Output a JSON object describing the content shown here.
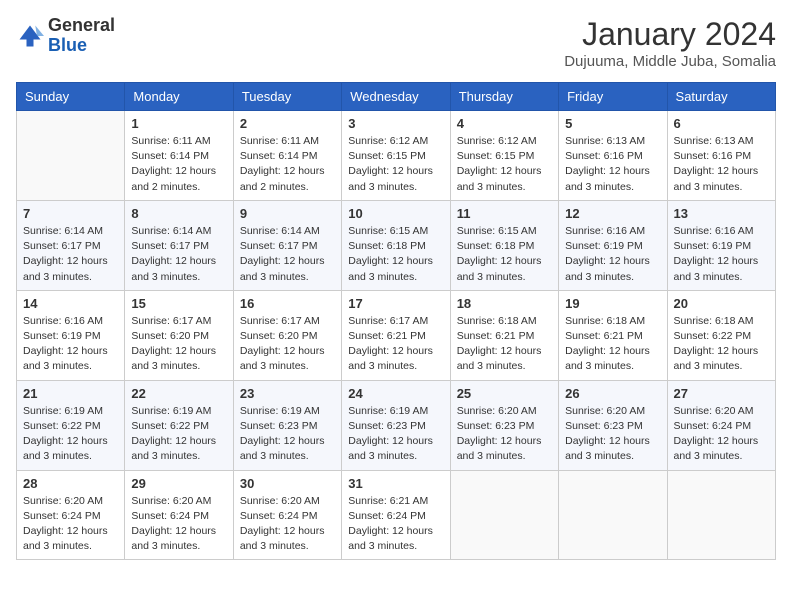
{
  "logo": {
    "general": "General",
    "blue": "Blue"
  },
  "header": {
    "month": "January 2024",
    "location": "Dujuuma, Middle Juba, Somalia"
  },
  "weekdays": [
    "Sunday",
    "Monday",
    "Tuesday",
    "Wednesday",
    "Thursday",
    "Friday",
    "Saturday"
  ],
  "weeks": [
    [
      {
        "day": null
      },
      {
        "day": 1,
        "sunrise": "6:11 AM",
        "sunset": "6:14 PM",
        "daylight": "12 hours and 2 minutes."
      },
      {
        "day": 2,
        "sunrise": "6:11 AM",
        "sunset": "6:14 PM",
        "daylight": "12 hours and 2 minutes."
      },
      {
        "day": 3,
        "sunrise": "6:12 AM",
        "sunset": "6:15 PM",
        "daylight": "12 hours and 3 minutes."
      },
      {
        "day": 4,
        "sunrise": "6:12 AM",
        "sunset": "6:15 PM",
        "daylight": "12 hours and 3 minutes."
      },
      {
        "day": 5,
        "sunrise": "6:13 AM",
        "sunset": "6:16 PM",
        "daylight": "12 hours and 3 minutes."
      },
      {
        "day": 6,
        "sunrise": "6:13 AM",
        "sunset": "6:16 PM",
        "daylight": "12 hours and 3 minutes."
      }
    ],
    [
      {
        "day": 7,
        "sunrise": "6:14 AM",
        "sunset": "6:17 PM",
        "daylight": "12 hours and 3 minutes."
      },
      {
        "day": 8,
        "sunrise": "6:14 AM",
        "sunset": "6:17 PM",
        "daylight": "12 hours and 3 minutes."
      },
      {
        "day": 9,
        "sunrise": "6:14 AM",
        "sunset": "6:17 PM",
        "daylight": "12 hours and 3 minutes."
      },
      {
        "day": 10,
        "sunrise": "6:15 AM",
        "sunset": "6:18 PM",
        "daylight": "12 hours and 3 minutes."
      },
      {
        "day": 11,
        "sunrise": "6:15 AM",
        "sunset": "6:18 PM",
        "daylight": "12 hours and 3 minutes."
      },
      {
        "day": 12,
        "sunrise": "6:16 AM",
        "sunset": "6:19 PM",
        "daylight": "12 hours and 3 minutes."
      },
      {
        "day": 13,
        "sunrise": "6:16 AM",
        "sunset": "6:19 PM",
        "daylight": "12 hours and 3 minutes."
      }
    ],
    [
      {
        "day": 14,
        "sunrise": "6:16 AM",
        "sunset": "6:19 PM",
        "daylight": "12 hours and 3 minutes."
      },
      {
        "day": 15,
        "sunrise": "6:17 AM",
        "sunset": "6:20 PM",
        "daylight": "12 hours and 3 minutes."
      },
      {
        "day": 16,
        "sunrise": "6:17 AM",
        "sunset": "6:20 PM",
        "daylight": "12 hours and 3 minutes."
      },
      {
        "day": 17,
        "sunrise": "6:17 AM",
        "sunset": "6:21 PM",
        "daylight": "12 hours and 3 minutes."
      },
      {
        "day": 18,
        "sunrise": "6:18 AM",
        "sunset": "6:21 PM",
        "daylight": "12 hours and 3 minutes."
      },
      {
        "day": 19,
        "sunrise": "6:18 AM",
        "sunset": "6:21 PM",
        "daylight": "12 hours and 3 minutes."
      },
      {
        "day": 20,
        "sunrise": "6:18 AM",
        "sunset": "6:22 PM",
        "daylight": "12 hours and 3 minutes."
      }
    ],
    [
      {
        "day": 21,
        "sunrise": "6:19 AM",
        "sunset": "6:22 PM",
        "daylight": "12 hours and 3 minutes."
      },
      {
        "day": 22,
        "sunrise": "6:19 AM",
        "sunset": "6:22 PM",
        "daylight": "12 hours and 3 minutes."
      },
      {
        "day": 23,
        "sunrise": "6:19 AM",
        "sunset": "6:23 PM",
        "daylight": "12 hours and 3 minutes."
      },
      {
        "day": 24,
        "sunrise": "6:19 AM",
        "sunset": "6:23 PM",
        "daylight": "12 hours and 3 minutes."
      },
      {
        "day": 25,
        "sunrise": "6:20 AM",
        "sunset": "6:23 PM",
        "daylight": "12 hours and 3 minutes."
      },
      {
        "day": 26,
        "sunrise": "6:20 AM",
        "sunset": "6:23 PM",
        "daylight": "12 hours and 3 minutes."
      },
      {
        "day": 27,
        "sunrise": "6:20 AM",
        "sunset": "6:24 PM",
        "daylight": "12 hours and 3 minutes."
      }
    ],
    [
      {
        "day": 28,
        "sunrise": "6:20 AM",
        "sunset": "6:24 PM",
        "daylight": "12 hours and 3 minutes."
      },
      {
        "day": 29,
        "sunrise": "6:20 AM",
        "sunset": "6:24 PM",
        "daylight": "12 hours and 3 minutes."
      },
      {
        "day": 30,
        "sunrise": "6:20 AM",
        "sunset": "6:24 PM",
        "daylight": "12 hours and 3 minutes."
      },
      {
        "day": 31,
        "sunrise": "6:21 AM",
        "sunset": "6:24 PM",
        "daylight": "12 hours and 3 minutes."
      },
      {
        "day": null
      },
      {
        "day": null
      },
      {
        "day": null
      }
    ]
  ]
}
